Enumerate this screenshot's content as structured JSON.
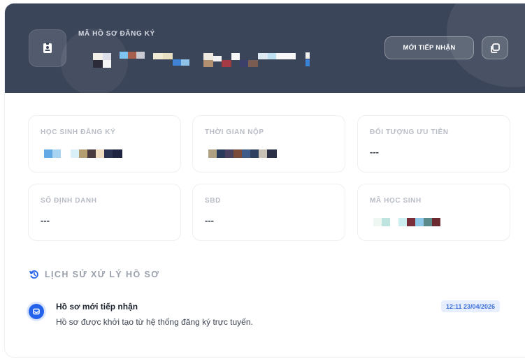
{
  "header": {
    "label": "MÃ HỒ SƠ ĐĂNG KÝ",
    "status": "MỚI TIẾP NHẬN",
    "colors": {
      "background": "#3b4559"
    },
    "icons": {
      "badge": "id-badge-icon",
      "copy": "copy-icon"
    }
  },
  "info": {
    "student": {
      "label": "HỌC SINH ĐĂNG KÝ"
    },
    "submit_time": {
      "label": "THỜI GIAN NỘP"
    },
    "priority": {
      "label": "ĐỐI TƯỢNG ƯU TIÊN",
      "value": "---"
    },
    "id_number": {
      "label": "SỐ ĐỊNH DANH",
      "value": "---"
    },
    "sbd": {
      "label": "SBD",
      "value": "---"
    },
    "student_code": {
      "label": "MÃ HỌC SINH"
    }
  },
  "history": {
    "title": "LỊCH SỬ XỬ LÝ HỒ SƠ",
    "icon": "history-icon",
    "events": [
      {
        "title": "Hồ sơ mới tiếp nhận",
        "description": "Hồ sơ được khởi tạo từ hệ thống đăng ký trực tuyến.",
        "time": "12:11 23/04/2026",
        "icon": "inbox-icon",
        "color": "#2563eb"
      }
    ]
  }
}
